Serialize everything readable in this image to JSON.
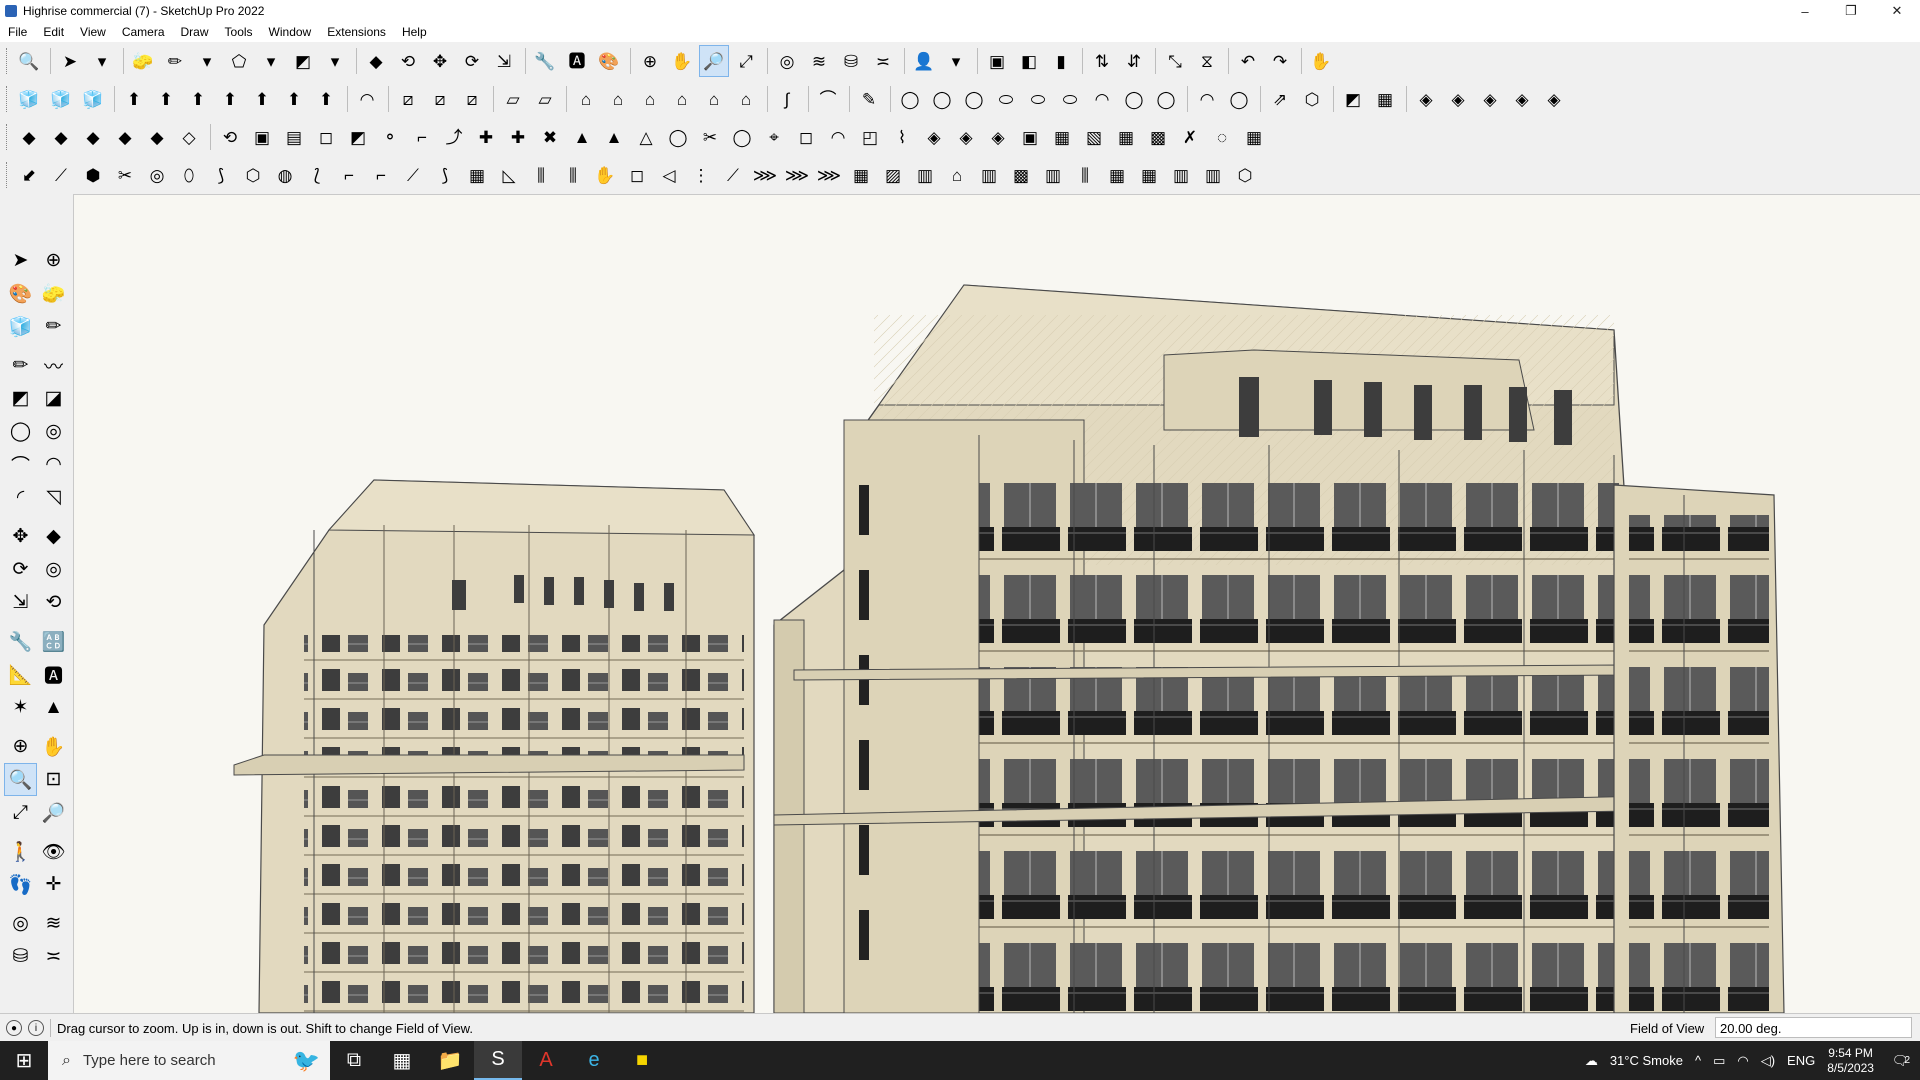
{
  "window": {
    "title": "Highrise commercial (7) - SketchUp Pro 2022",
    "controls": [
      "–",
      "❐",
      "✕"
    ]
  },
  "menu": [
    "File",
    "Edit",
    "View",
    "Camera",
    "Draw",
    "Tools",
    "Window",
    "Extensions",
    "Help"
  ],
  "toolbar_rows": [
    [
      "🔍",
      "sep",
      "➤",
      "▾",
      "sep",
      "🧽",
      "✏",
      "▾",
      "⬠",
      "▾",
      "◩",
      "▾",
      "sep",
      "◆",
      "⟲",
      "✥",
      "⟳",
      "⇲",
      "sep",
      "🔧",
      "🅰",
      "🎨",
      "sep",
      "⊕",
      "✋",
      "🔎",
      "⤢",
      "sep",
      "◎",
      "≋",
      "⛁",
      "≍",
      "sep",
      "👤",
      "▾",
      "sep",
      "▣",
      "◧",
      "▮",
      "sep",
      "⇅",
      "⇵",
      "sep",
      "⤡",
      "⧖",
      "sep",
      "↶",
      "↷",
      "sep",
      "✋"
    ],
    [
      "🧊",
      "🧊",
      "🧊",
      "sep",
      "⬆",
      "⬆",
      "⬆",
      "⬆",
      "⬆",
      "⬆",
      "⬆",
      "sep",
      "◠",
      "sep",
      "⧄",
      "⧄",
      "⧄",
      "sep",
      "▱",
      "▱",
      "sep",
      "⌂",
      "⌂",
      "⌂",
      "⌂",
      "⌂",
      "⌂",
      "sep",
      "∫",
      "sep",
      "⌒",
      "sep",
      "✎",
      "sep",
      "◯",
      "◯",
      "◯",
      "⬭",
      "⬭",
      "⬭",
      "◠",
      "◯",
      "◯",
      "sep",
      "◠",
      "◯",
      "sep",
      "⇗",
      "⬡",
      "sep",
      "◩",
      "▦",
      "sep",
      "◈",
      "◈",
      "◈",
      "◈",
      "◈"
    ],
    [
      "◆",
      "◆",
      "◆",
      "◆",
      "◆",
      "◇",
      "sep",
      "⟲",
      "▣",
      "▤",
      "◻",
      "◩",
      "⚬",
      "⌐",
      "⤴",
      "✚",
      "✚",
      "✖",
      "▲",
      "▲",
      "△",
      "◯",
      "✂",
      "◯",
      "⌖",
      "◻",
      "◠",
      "◰",
      "⌇",
      "◈",
      "◈",
      "◈",
      "▣",
      "▦",
      "▧",
      "▦",
      "▩",
      "✗",
      "◌",
      "▦"
    ],
    [
      "⬋",
      "⟋",
      "⬢",
      "✂",
      "◎",
      "⬯",
      "⟆",
      "⬡",
      "◍",
      "⟅",
      "⌐",
      "⌐",
      "⟋",
      "⟆",
      "▦",
      "◺",
      "⫼",
      "⫼",
      "✋",
      "◻",
      "◁",
      "⋮",
      "⟋",
      "⋙",
      "⋙",
      "⋙",
      "▦",
      "▨",
      "▥",
      "⌂",
      "▥",
      "▩",
      "▥",
      "⫼",
      "▦",
      "▦",
      "▥",
      "▥",
      "⬡"
    ]
  ],
  "left_tools": [
    [
      "➤",
      "⊕"
    ],
    [
      "🎨",
      "🧽"
    ],
    [
      "🧊",
      "✏"
    ],
    "gap",
    [
      "✏",
      "〰"
    ],
    [
      "◩",
      "◪"
    ],
    [
      "◯",
      "◎"
    ],
    [
      "⌒",
      "◠"
    ],
    [
      "◜",
      "◹"
    ],
    "gap",
    [
      "✥",
      "◆"
    ],
    [
      "⟳",
      "◎"
    ],
    [
      "⇲",
      "⟲"
    ],
    "gap",
    [
      "🔧",
      "🔠"
    ],
    [
      "📐",
      "🅰"
    ],
    [
      "✶",
      "▲"
    ],
    "gap",
    [
      "⊕",
      "✋"
    ],
    [
      "🔍",
      "⊡"
    ],
    [
      "⤢",
      "🔎"
    ],
    "gap",
    [
      "🚶",
      "👁"
    ],
    [
      "👣",
      "✛"
    ],
    "gap",
    [
      "◎",
      "≋"
    ],
    [
      "⛁",
      "≍"
    ]
  ],
  "status": {
    "message": "Drag cursor to zoom.  Up is in, down is out. Shift to change Field of View.",
    "vcb_label": "Field of View",
    "vcb_value": "20.00 deg."
  },
  "taskbar": {
    "search_placeholder": "Type here to search",
    "apps": [
      "⧉",
      "▦",
      "📁",
      "S",
      "A",
      "e",
      "■"
    ],
    "weather": "31°C  Smoke",
    "language": "ENG",
    "time": "9:54 PM",
    "date": "8/5/2023",
    "notification_count": "2"
  },
  "colors": {
    "facade": "#e2d9bf",
    "facade_shadow": "#cfc4a5",
    "roof_top": "#e8e0c8",
    "window_dark": "#3a3a3a",
    "edge": "#4a4a4a"
  }
}
